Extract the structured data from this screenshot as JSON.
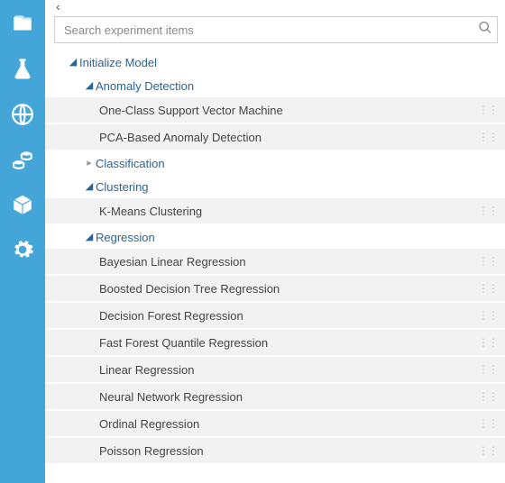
{
  "sidebar": {
    "items": [
      {
        "name": "projects"
      },
      {
        "name": "experiments"
      },
      {
        "name": "web-services"
      },
      {
        "name": "datasets"
      },
      {
        "name": "trained-models"
      },
      {
        "name": "settings"
      }
    ]
  },
  "search": {
    "placeholder": "Search experiment items"
  },
  "tree": {
    "root": {
      "label": "Initialize Model"
    },
    "anomaly": {
      "label": "Anomaly Detection",
      "items": [
        {
          "label": "One-Class Support Vector Machine"
        },
        {
          "label": "PCA-Based Anomaly Detection"
        }
      ]
    },
    "classification": {
      "label": "Classification"
    },
    "clustering": {
      "label": "Clustering",
      "items": [
        {
          "label": "K-Means Clustering"
        }
      ]
    },
    "regression": {
      "label": "Regression",
      "items": [
        {
          "label": "Bayesian Linear Regression"
        },
        {
          "label": "Boosted Decision Tree Regression"
        },
        {
          "label": "Decision Forest Regression"
        },
        {
          "label": "Fast Forest Quantile Regression"
        },
        {
          "label": "Linear Regression"
        },
        {
          "label": "Neural Network Regression"
        },
        {
          "label": "Ordinal Regression"
        },
        {
          "label": "Poisson Regression"
        }
      ]
    }
  }
}
